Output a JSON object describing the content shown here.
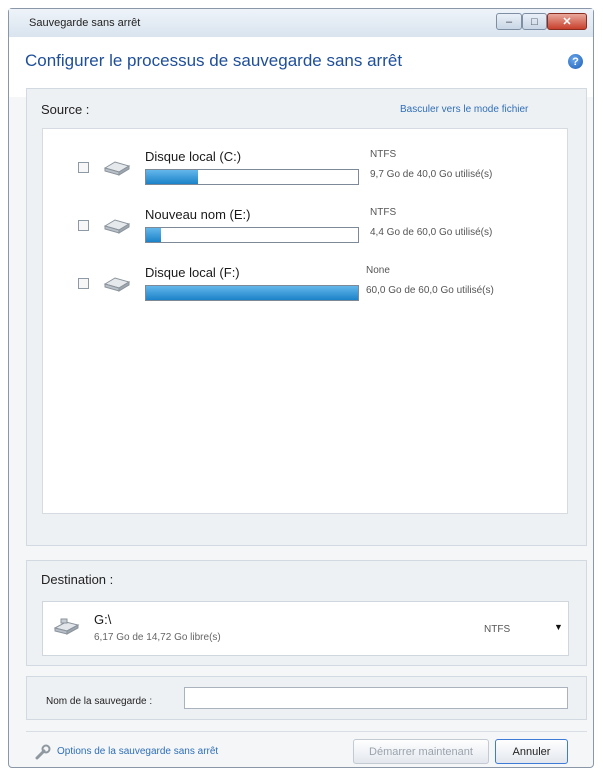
{
  "window": {
    "title": "Sauvegarde sans arrêt",
    "controls": {
      "minimize": "–",
      "maximize": "□",
      "close": "✕"
    }
  },
  "header": {
    "heading": "Configurer le processus de sauvegarde sans arrêt",
    "help_icon": "?"
  },
  "source": {
    "label": "Source :",
    "switch_link": "Basculer vers le mode fichier",
    "drives": [
      {
        "name": "Disque local (C:)",
        "filesystem": "NTFS",
        "usage": "9,7 Go de 40,0 Go utilisé(s)",
        "used_fraction": 0.243,
        "checked": false,
        "icon": "hard-drive-icon"
      },
      {
        "name": "Nouveau nom (E:)",
        "filesystem": "NTFS",
        "usage": "4,4 Go de 60,0 Go utilisé(s)",
        "used_fraction": 0.073,
        "checked": false,
        "icon": "hard-drive-icon"
      },
      {
        "name": "Disque local (F:)",
        "filesystem": "None",
        "usage": "60,0 Go de 60,0 Go utilisé(s)",
        "used_fraction": 1.0,
        "checked": false,
        "icon": "hard-drive-icon"
      }
    ]
  },
  "destination": {
    "label": "Destination :",
    "selected": {
      "name": "G:\\",
      "free": "6,17 Go de 14,72 Go libre(s)",
      "filesystem": "NTFS",
      "icon": "usb-drive-icon"
    },
    "dropdown_arrow": "▼"
  },
  "backup_name": {
    "label": "Nom de la sauvegarde :",
    "value": ""
  },
  "footer": {
    "options_link": "Options de la sauvegarde sans arrêt",
    "options_icon": "wrench-icon",
    "start_button": "Démarrer maintenant",
    "cancel_button": "Annuler"
  },
  "colors": {
    "accent": "#1f4f99",
    "link": "#2f6fb7",
    "progress": "#1c82c8"
  }
}
